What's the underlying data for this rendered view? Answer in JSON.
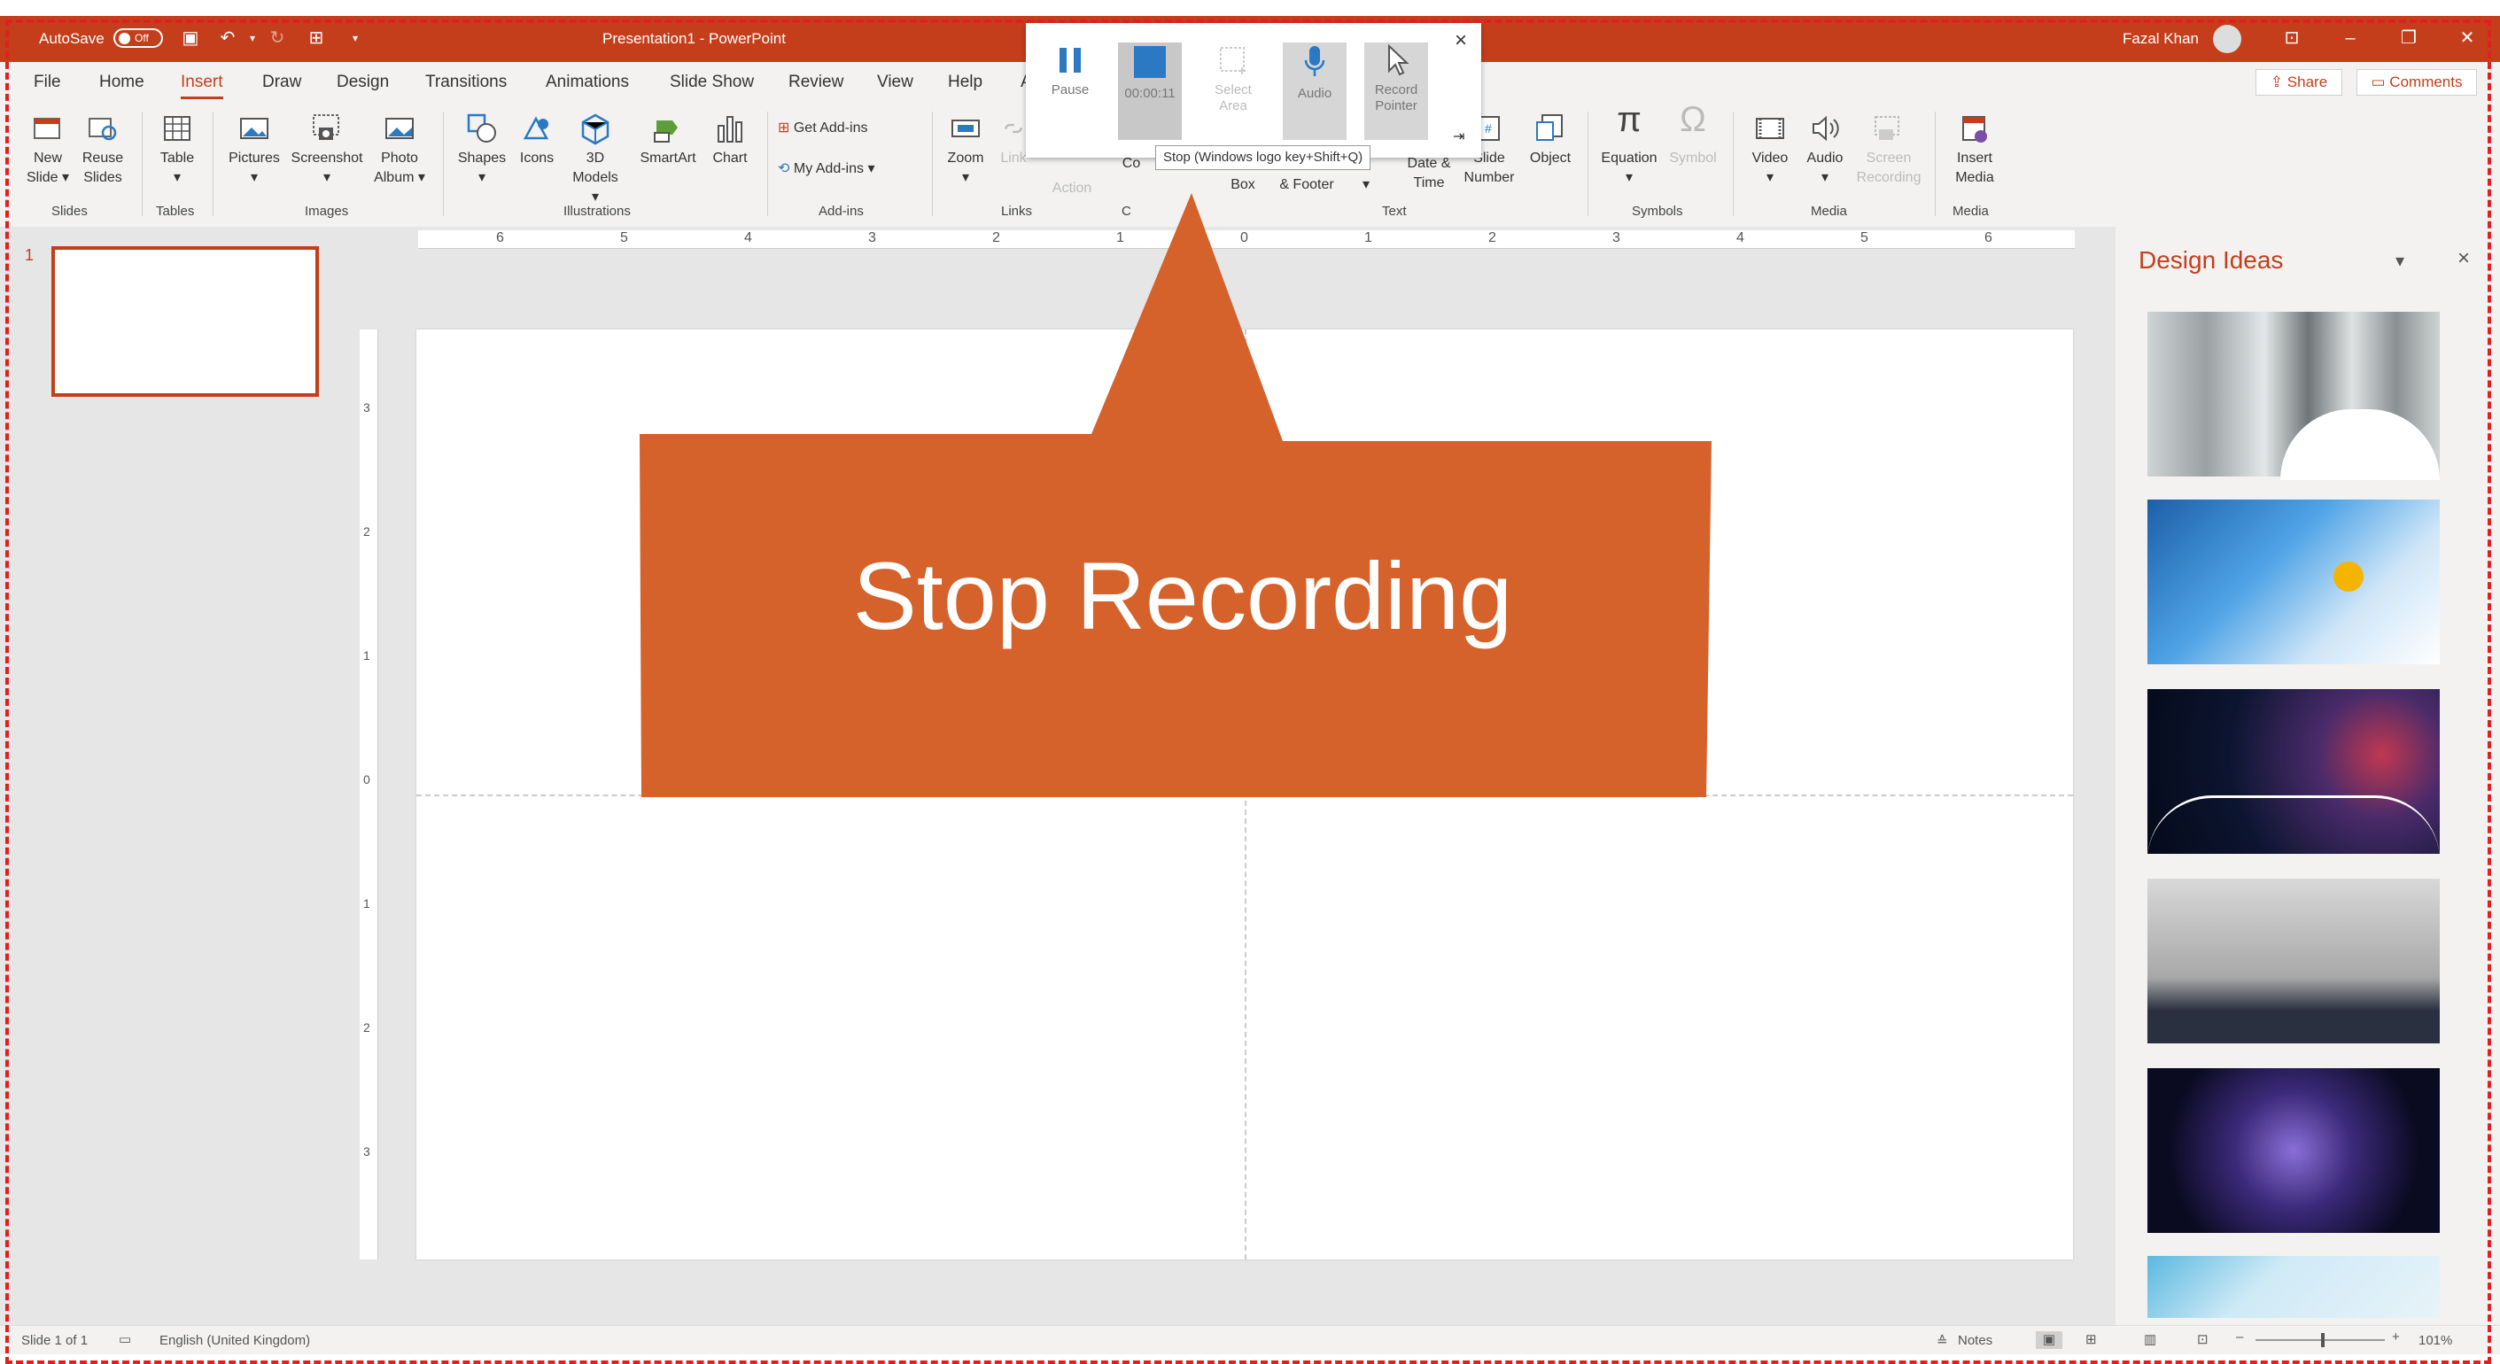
{
  "titlebar": {
    "autosave_label": "AutoSave",
    "autosave_state": "Off",
    "document_title": "Presentation1 - PowerPoint",
    "user_name": "Fazal Khan"
  },
  "tabs": [
    "File",
    "Home",
    "Insert",
    "Draw",
    "Design",
    "Transitions",
    "Animations",
    "Slide Show",
    "Review",
    "View",
    "Help"
  ],
  "tab_partial": "A",
  "share_label": "Share",
  "comments_label": "Comments",
  "ribbon": {
    "new_slide": [
      "New",
      "Slide"
    ],
    "reuse_slides": [
      "Reuse",
      "Slides"
    ],
    "table": "Table",
    "pictures": "Pictures",
    "screenshot": "Screenshot",
    "photo_album": [
      "Photo",
      "Album"
    ],
    "shapes": "Shapes",
    "icons": "Icons",
    "models_3d": [
      "3D",
      "Models"
    ],
    "smartart": "SmartArt",
    "chart": "Chart",
    "get_addins": "Get Add-ins",
    "my_addins": "My Add-ins",
    "zoom": "Zoom",
    "link": "Link",
    "action": "Action",
    "comment_partial": "Co",
    "textbox_partial": "Box",
    "header_footer_partial": "& Footer",
    "date_time": [
      "Date &",
      "Time"
    ],
    "slide_number": [
      "Slide",
      "Number"
    ],
    "object": "Object",
    "equation": "Equation",
    "symbol": "Symbol",
    "video": "Video",
    "audio": "Audio",
    "screen_recording": [
      "Screen",
      "Recording"
    ],
    "insert_media": [
      "Insert",
      "Media"
    ],
    "groups": {
      "slides": "Slides",
      "tables": "Tables",
      "images": "Images",
      "illustrations": "Illustrations",
      "addins": "Add-ins",
      "links": "Links",
      "comments_partial": "C",
      "text": "Text",
      "symbols": "Symbols",
      "media": "Media",
      "media2": "Media"
    }
  },
  "recording_toolbar": {
    "pause": "Pause",
    "timer": "00:00:11",
    "select_area": [
      "Select",
      "Area"
    ],
    "audio": "Audio",
    "record_pointer": [
      "Record",
      "Pointer"
    ],
    "close": "×",
    "pin": "⇥",
    "tooltip": "Stop (Windows logo key+Shift+Q)"
  },
  "ruler": {
    "h_labels": [
      "6",
      "5",
      "4",
      "3",
      "2",
      "1",
      "0",
      "1",
      "2",
      "3",
      "4",
      "5",
      "6"
    ],
    "v_labels": [
      "3",
      "2",
      "1",
      "0",
      "1",
      "2",
      "3"
    ]
  },
  "thumbnail": {
    "number": "1"
  },
  "design_pane": {
    "title": "Design Ideas",
    "close": "×",
    "dropdown": "▾"
  },
  "callout": {
    "text": "Stop Recording",
    "color": "#d4622a"
  },
  "statusbar": {
    "slide_info": "Slide 1 of 1",
    "language": "English (United Kingdom)",
    "notes": "Notes",
    "zoom": "101%"
  },
  "colors": {
    "accent": "#c43e1c",
    "callout": "#d4622a",
    "dashed_border": "#e02020"
  }
}
